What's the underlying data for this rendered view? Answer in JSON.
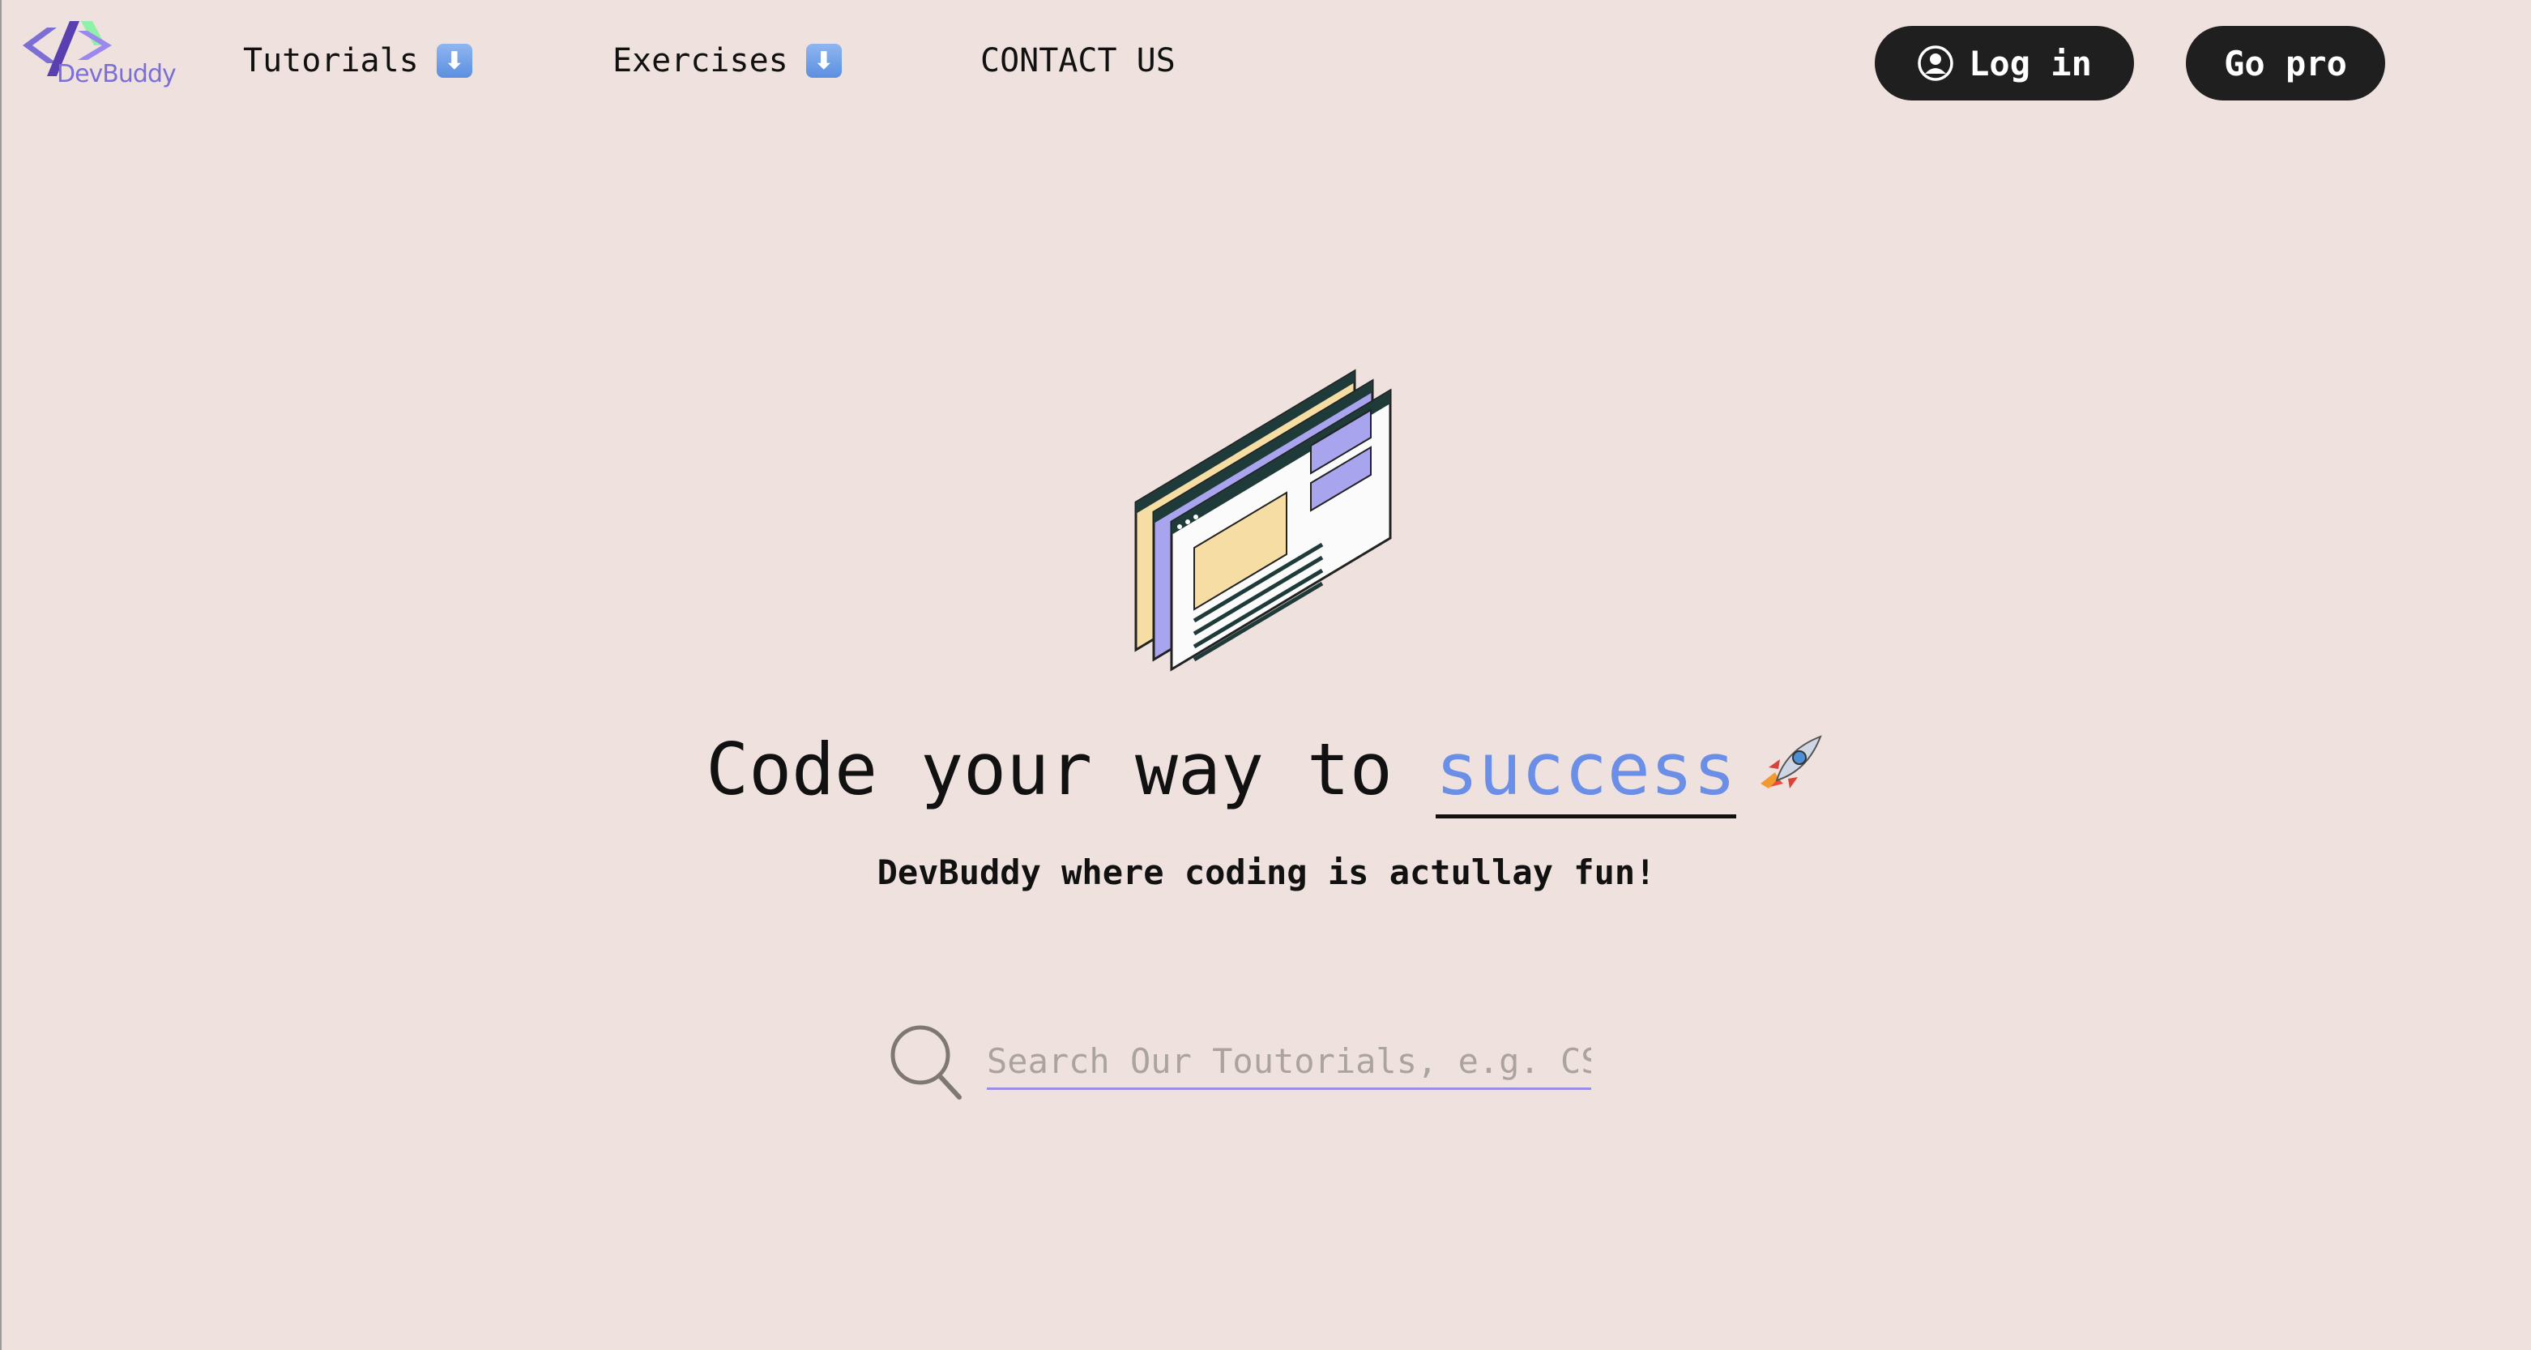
{
  "nav": {
    "logo_text": "DevBuddy",
    "tutorials_label": "Tutorials",
    "exercises_label": "Exercises",
    "arrow_glyph": "⬇",
    "contact_label": "CONTACT US",
    "login_label": "Log in",
    "pro_label": "Go pro"
  },
  "hero": {
    "headline_prefix": "Code your way to ",
    "headline_accent": "success",
    "subtitle": "DevBuddy where coding is actullay fun!"
  },
  "search": {
    "placeholder": "Search Our Toutorials, e.g. CSS",
    "value": ""
  },
  "colors": {
    "background": "#efe2de",
    "accent": "#6b8ee6",
    "button": "#1f1f1f",
    "input_underline": "#9a8de6"
  }
}
